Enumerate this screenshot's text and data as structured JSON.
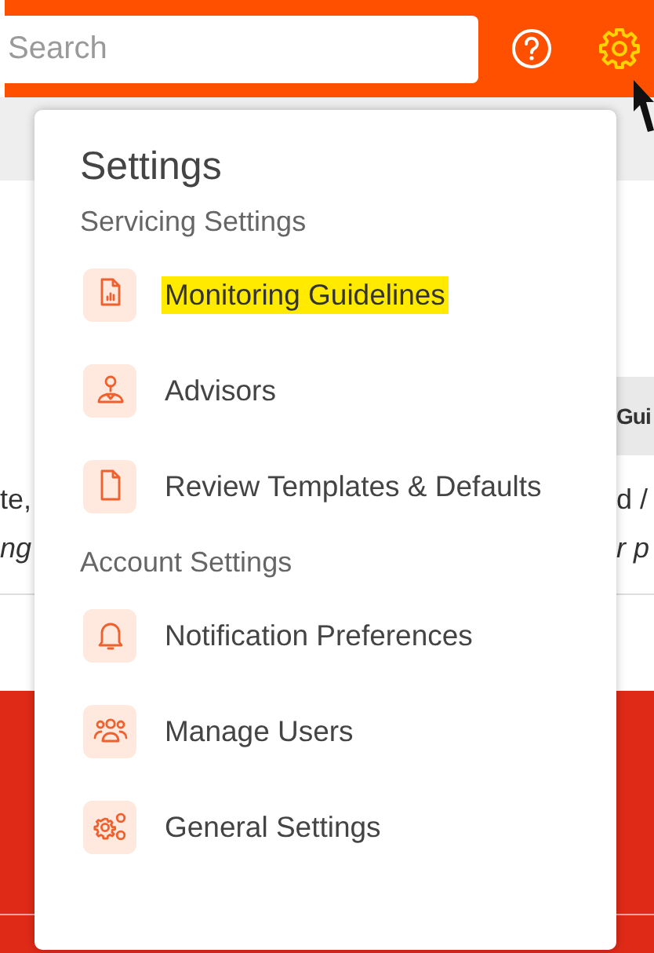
{
  "header": {
    "search": {
      "placeholder": "Search"
    },
    "settings_active": true
  },
  "background": {
    "column_header": "Gui",
    "left_lines": [
      {
        "text": "te,",
        "italic": false
      },
      {
        "text": "ng",
        "italic": true
      }
    ],
    "right_lines": [
      {
        "text": "d /",
        "italic": false
      },
      {
        "text": "r p",
        "italic": true
      }
    ]
  },
  "menu": {
    "title": "Settings",
    "sections": [
      {
        "title": "Servicing Settings",
        "items": [
          {
            "label": "Monitoring Guidelines",
            "highlighted": true
          },
          {
            "label": "Advisors",
            "highlighted": false
          },
          {
            "label": "Review Templates & Defaults",
            "highlighted": false
          }
        ]
      },
      {
        "title": "Account Settings",
        "items": [
          {
            "label": "Notification Preferences",
            "highlighted": false
          },
          {
            "label": "Manage Users",
            "highlighted": false
          },
          {
            "label": "General Settings",
            "highlighted": false
          }
        ]
      }
    ]
  }
}
